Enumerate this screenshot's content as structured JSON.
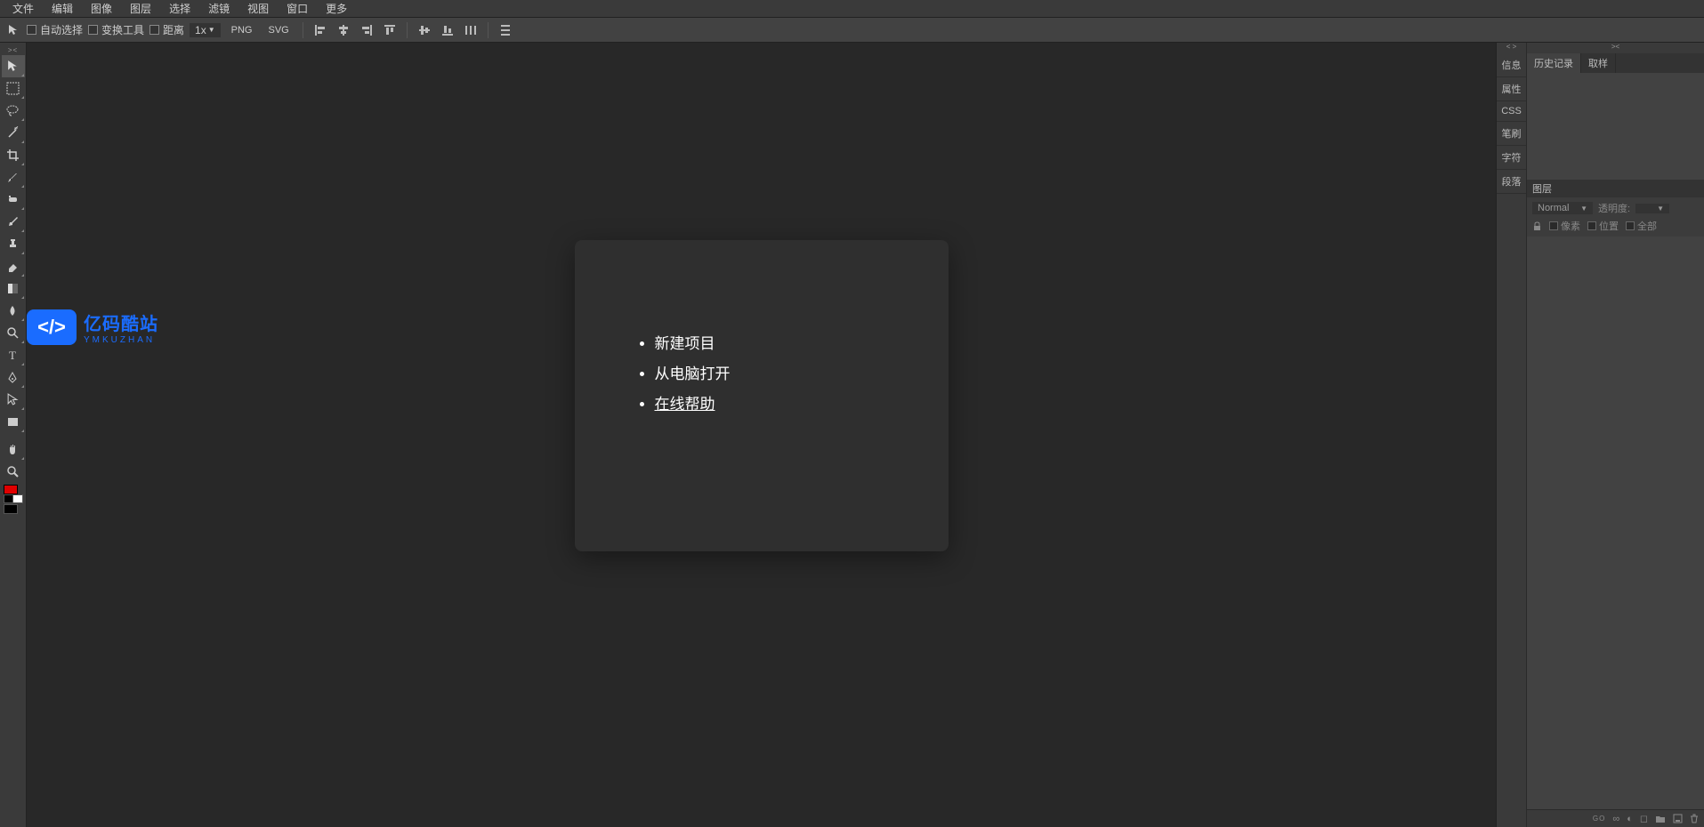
{
  "menubar": {
    "file": "文件",
    "edit": "编辑",
    "image": "图像",
    "layer": "图层",
    "select": "选择",
    "filter": "滤镜",
    "view": "视图",
    "window": "窗口",
    "more": "更多"
  },
  "optionsbar": {
    "auto_select": "自动选择",
    "transform_tool": "变换工具",
    "distance": "距离",
    "zoom_dd": "1x",
    "png_btn": "PNG",
    "svg_btn": "SVG"
  },
  "welcome": {
    "new_project": "新建项目",
    "open_from_computer": "从电脑打开",
    "online_help": "在线帮助"
  },
  "watermark": {
    "title": "亿码酷站",
    "subtitle": "YMKUZHAN"
  },
  "right_tabs": {
    "info": "信息",
    "properties": "属性",
    "css": "CSS",
    "brushes": "笔刷",
    "character": "字符",
    "paragraph": "段落"
  },
  "panels": {
    "history_tab": "历史记录",
    "swatch_tab": "取样",
    "layers_tab": "图层",
    "blend_mode": "Normal",
    "opacity_label": "透明度:",
    "lock_pixels": "像素",
    "lock_position": "位置",
    "lock_all": "全部"
  },
  "footer_icons": {
    "link": "GO",
    "chain": "⧉",
    "contrast": "◐",
    "mask": "▣",
    "folder": "📁",
    "new": "▫",
    "trash": "🗑"
  }
}
